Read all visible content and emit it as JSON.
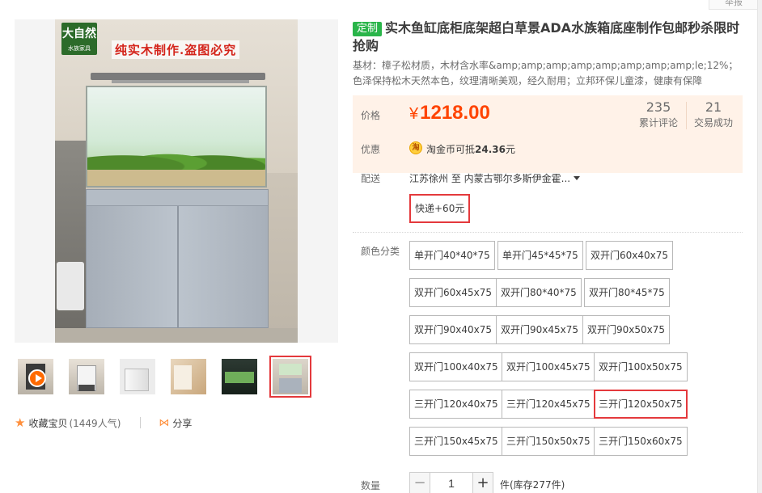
{
  "topbar": {
    "report_label": "举报"
  },
  "gallery": {
    "logo_text": "大自然",
    "logo_sub": "水族家具",
    "banner_text": "纯实木制作.盗图必究",
    "thumbnail_count": 6,
    "active_thumbnail": 6
  },
  "social": {
    "favorite_label": "收藏宝贝",
    "favorite_count": "(1449人气)",
    "share_label": "分享"
  },
  "product": {
    "tag": "定制",
    "title": "实木鱼缸底柜底架超白草景ADA水族箱底座制作包邮秒杀限时抢购",
    "subtitle": "基材：樟子松材质，木材含水率&amp;amp;amp;amp;amp;amp;amp;amp;le;12%；色泽保持松木天然本色，纹理清晰美观，经久耐用；立邦环保儿童漆，健康有保障"
  },
  "price": {
    "label": "价格",
    "currency": "¥",
    "value": "1218.00",
    "reviews_count": "235",
    "reviews_label": "累计评论",
    "sales_count": "21",
    "sales_label": "交易成功"
  },
  "promo": {
    "label": "优惠",
    "coin_icon": "淘",
    "text_prefix": "淘金币可抵",
    "amount": "24.36",
    "text_suffix": "元"
  },
  "shipping": {
    "label": "配送",
    "route": "江苏徐州 至  内蒙古鄂尔多斯伊金霍...",
    "option": "快递+60元"
  },
  "colors": {
    "label": "颜色分类",
    "options": [
      "单开门40*40*75",
      "单开门45*45*75",
      "双开门60x40x75",
      "双开门60x45x75",
      "双开门80*40*75",
      "双开门80*45*75",
      "双开门90x40x75",
      "双开门90x45x75",
      "双开门90x50x75",
      "双开门100x40x75",
      "双开门100x45x75",
      "双开门100x50x75",
      "三开门120x40x75",
      "三开门120x45x75",
      "三开门120x50x75",
      "三开门150x45x75",
      "三开门150x50x75",
      "三开门150x60x75"
    ],
    "selected": "三开门120x50x75"
  },
  "quantity": {
    "label": "数量",
    "minus": "−",
    "value": "1",
    "plus": "+",
    "stock": "件(库存277件)"
  },
  "colors_theme": {
    "accent": "#ff4400",
    "selected_border": "#e4393c",
    "tag_green": "#2ab54a",
    "price_bg": "#fff2e8"
  }
}
